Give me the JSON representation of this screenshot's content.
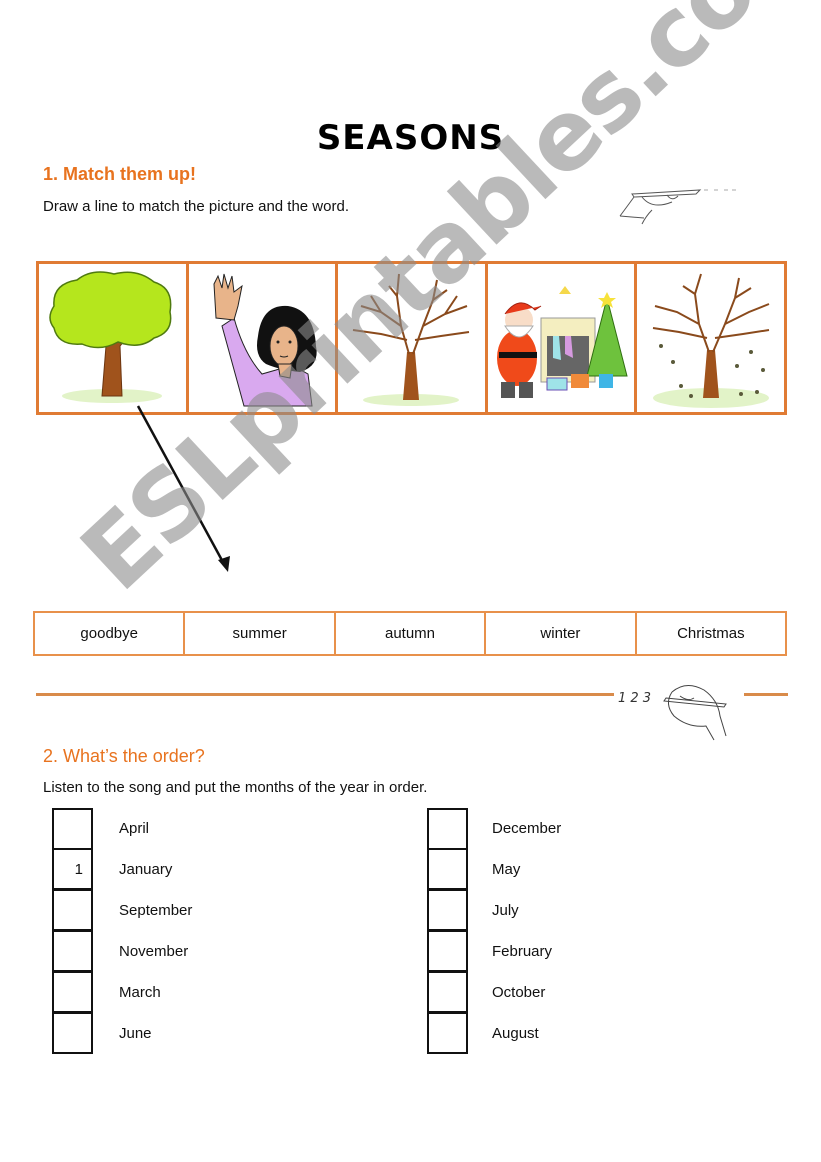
{
  "page": {
    "title": "SEASONS"
  },
  "section1": {
    "heading": "1. Match them up!",
    "instruction": "Draw a line to match the picture and the word.",
    "pictures": [
      {
        "name": "green-tree",
        "depicts": "green leafy tree"
      },
      {
        "name": "waving-woman",
        "depicts": "woman waving"
      },
      {
        "name": "bare-tree",
        "depicts": "bare winter tree"
      },
      {
        "name": "santa-christmas",
        "depicts": "Santa with fireplace and Christmas tree"
      },
      {
        "name": "autumn-tree",
        "depicts": "tree with falling leaves"
      }
    ],
    "words": [
      "goodbye",
      "summer",
      "autumn",
      "winter",
      "Christmas"
    ],
    "example_match": {
      "from_picture": 1,
      "to_word": 2
    }
  },
  "section2": {
    "heading": "2. What’s the order?",
    "instruction": "Listen to the song and put the months of the year in order.",
    "left_months": [
      {
        "month": "April",
        "number": ""
      },
      {
        "month": "January",
        "number": "1"
      },
      {
        "month": "September",
        "number": ""
      },
      {
        "month": "November",
        "number": ""
      },
      {
        "month": "March",
        "number": ""
      },
      {
        "month": "June",
        "number": ""
      }
    ],
    "right_months": [
      {
        "month": "December",
        "number": ""
      },
      {
        "month": "May",
        "number": ""
      },
      {
        "month": "July",
        "number": ""
      },
      {
        "month": "February",
        "number": ""
      },
      {
        "month": "October",
        "number": ""
      },
      {
        "month": "August",
        "number": ""
      }
    ]
  },
  "divider": {
    "numbers_text": "1 2 3"
  },
  "colors": {
    "accent_orange": "#e8731f",
    "border_orange": "#e07b34",
    "watermark_gray": "#8c8c8c"
  },
  "watermark": "ESLprintables.com"
}
